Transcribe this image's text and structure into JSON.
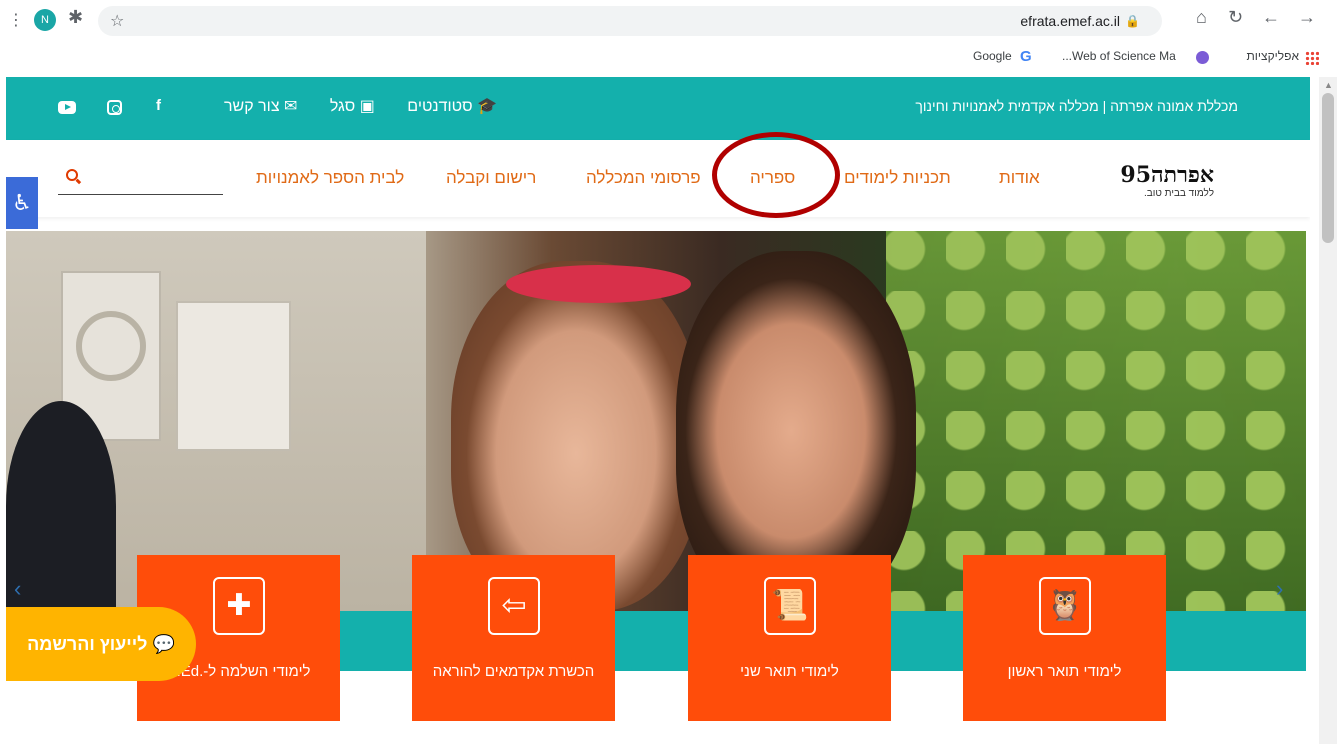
{
  "browser": {
    "url": "efrata.emef.ac.il",
    "profile_initial": "N",
    "bookmarks": {
      "apps": "אפליקציות",
      "wos": "Web of Science Ma...",
      "google": "Google"
    }
  },
  "topbar": {
    "college_name": "מכללת אמונה אפרתה | מכללה אקדמית לאמנויות וחינוך",
    "links": [
      "סטודנטים",
      "סגל",
      "צור קשר"
    ]
  },
  "nav": {
    "logo_main": "אפרתה95",
    "logo_sub": "ללמוד בבית טוב.",
    "items": [
      "אודות",
      "תכניות לימודים",
      "ספריה",
      "פרסומי המכללה",
      "רישום וקבלה",
      "לבית הספר לאמנויות"
    ]
  },
  "tiles": [
    {
      "label": "לימודי תואר ראשון",
      "icon": "owl-icon"
    },
    {
      "label": "לימודי תואר שני",
      "icon": "med-scroll-icon"
    },
    {
      "label": "הכשרת אקדמאים להוראה",
      "icon": "easel-icon"
    },
    {
      "label": "לימודי השלמה ל-.B.Ed",
      "icon": "puzzle-icon"
    }
  ],
  "consult": {
    "label": "לייעוץ והרשמה"
  },
  "colors": {
    "teal": "#14b0ac",
    "orange": "#ff4d0a",
    "nav_text": "#e06a16",
    "consult": "#ffb400"
  }
}
